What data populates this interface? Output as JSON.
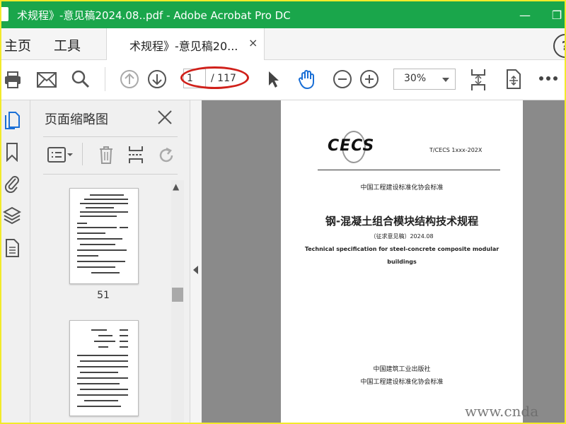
{
  "window": {
    "title": "术规程》-意见稿2024.08..pdf - Adobe Acrobat Pro DC",
    "minimize_label": "—",
    "restore_label": "❐"
  },
  "tabs": {
    "home": "主页",
    "tools": "工具",
    "document": "术规程》-意见稿20...",
    "close": "×",
    "help": "?"
  },
  "toolbar": {
    "current_page": "1",
    "total_pages": "/ 117",
    "zoom": "30%"
  },
  "panel": {
    "title": "页面缩略图",
    "thumbnails": [
      {
        "label": "51"
      },
      {
        "label": ""
      }
    ]
  },
  "document": {
    "logo_text": "CECS",
    "standard_code": "T/CECS 1xxx-202X",
    "association": "中国工程建设标准化协会标准",
    "title_cn": "钢-混凝土组合模块结构技术规程",
    "status": "（征求意见稿）2024.08",
    "title_en_line1": "Technical specification for steel-concrete composite modular",
    "title_en_line2": "buildings",
    "publisher": "中国建筑工业出版社",
    "publisher2": "中国工程建设标准化协会标准"
  },
  "watermark": "www.cnda",
  "colors": {
    "titlebar": "#1aa64b",
    "accent_blue": "#1a6fd6",
    "highlight_red": "#d0201a",
    "frame_yellow": "#f2ea2a"
  }
}
